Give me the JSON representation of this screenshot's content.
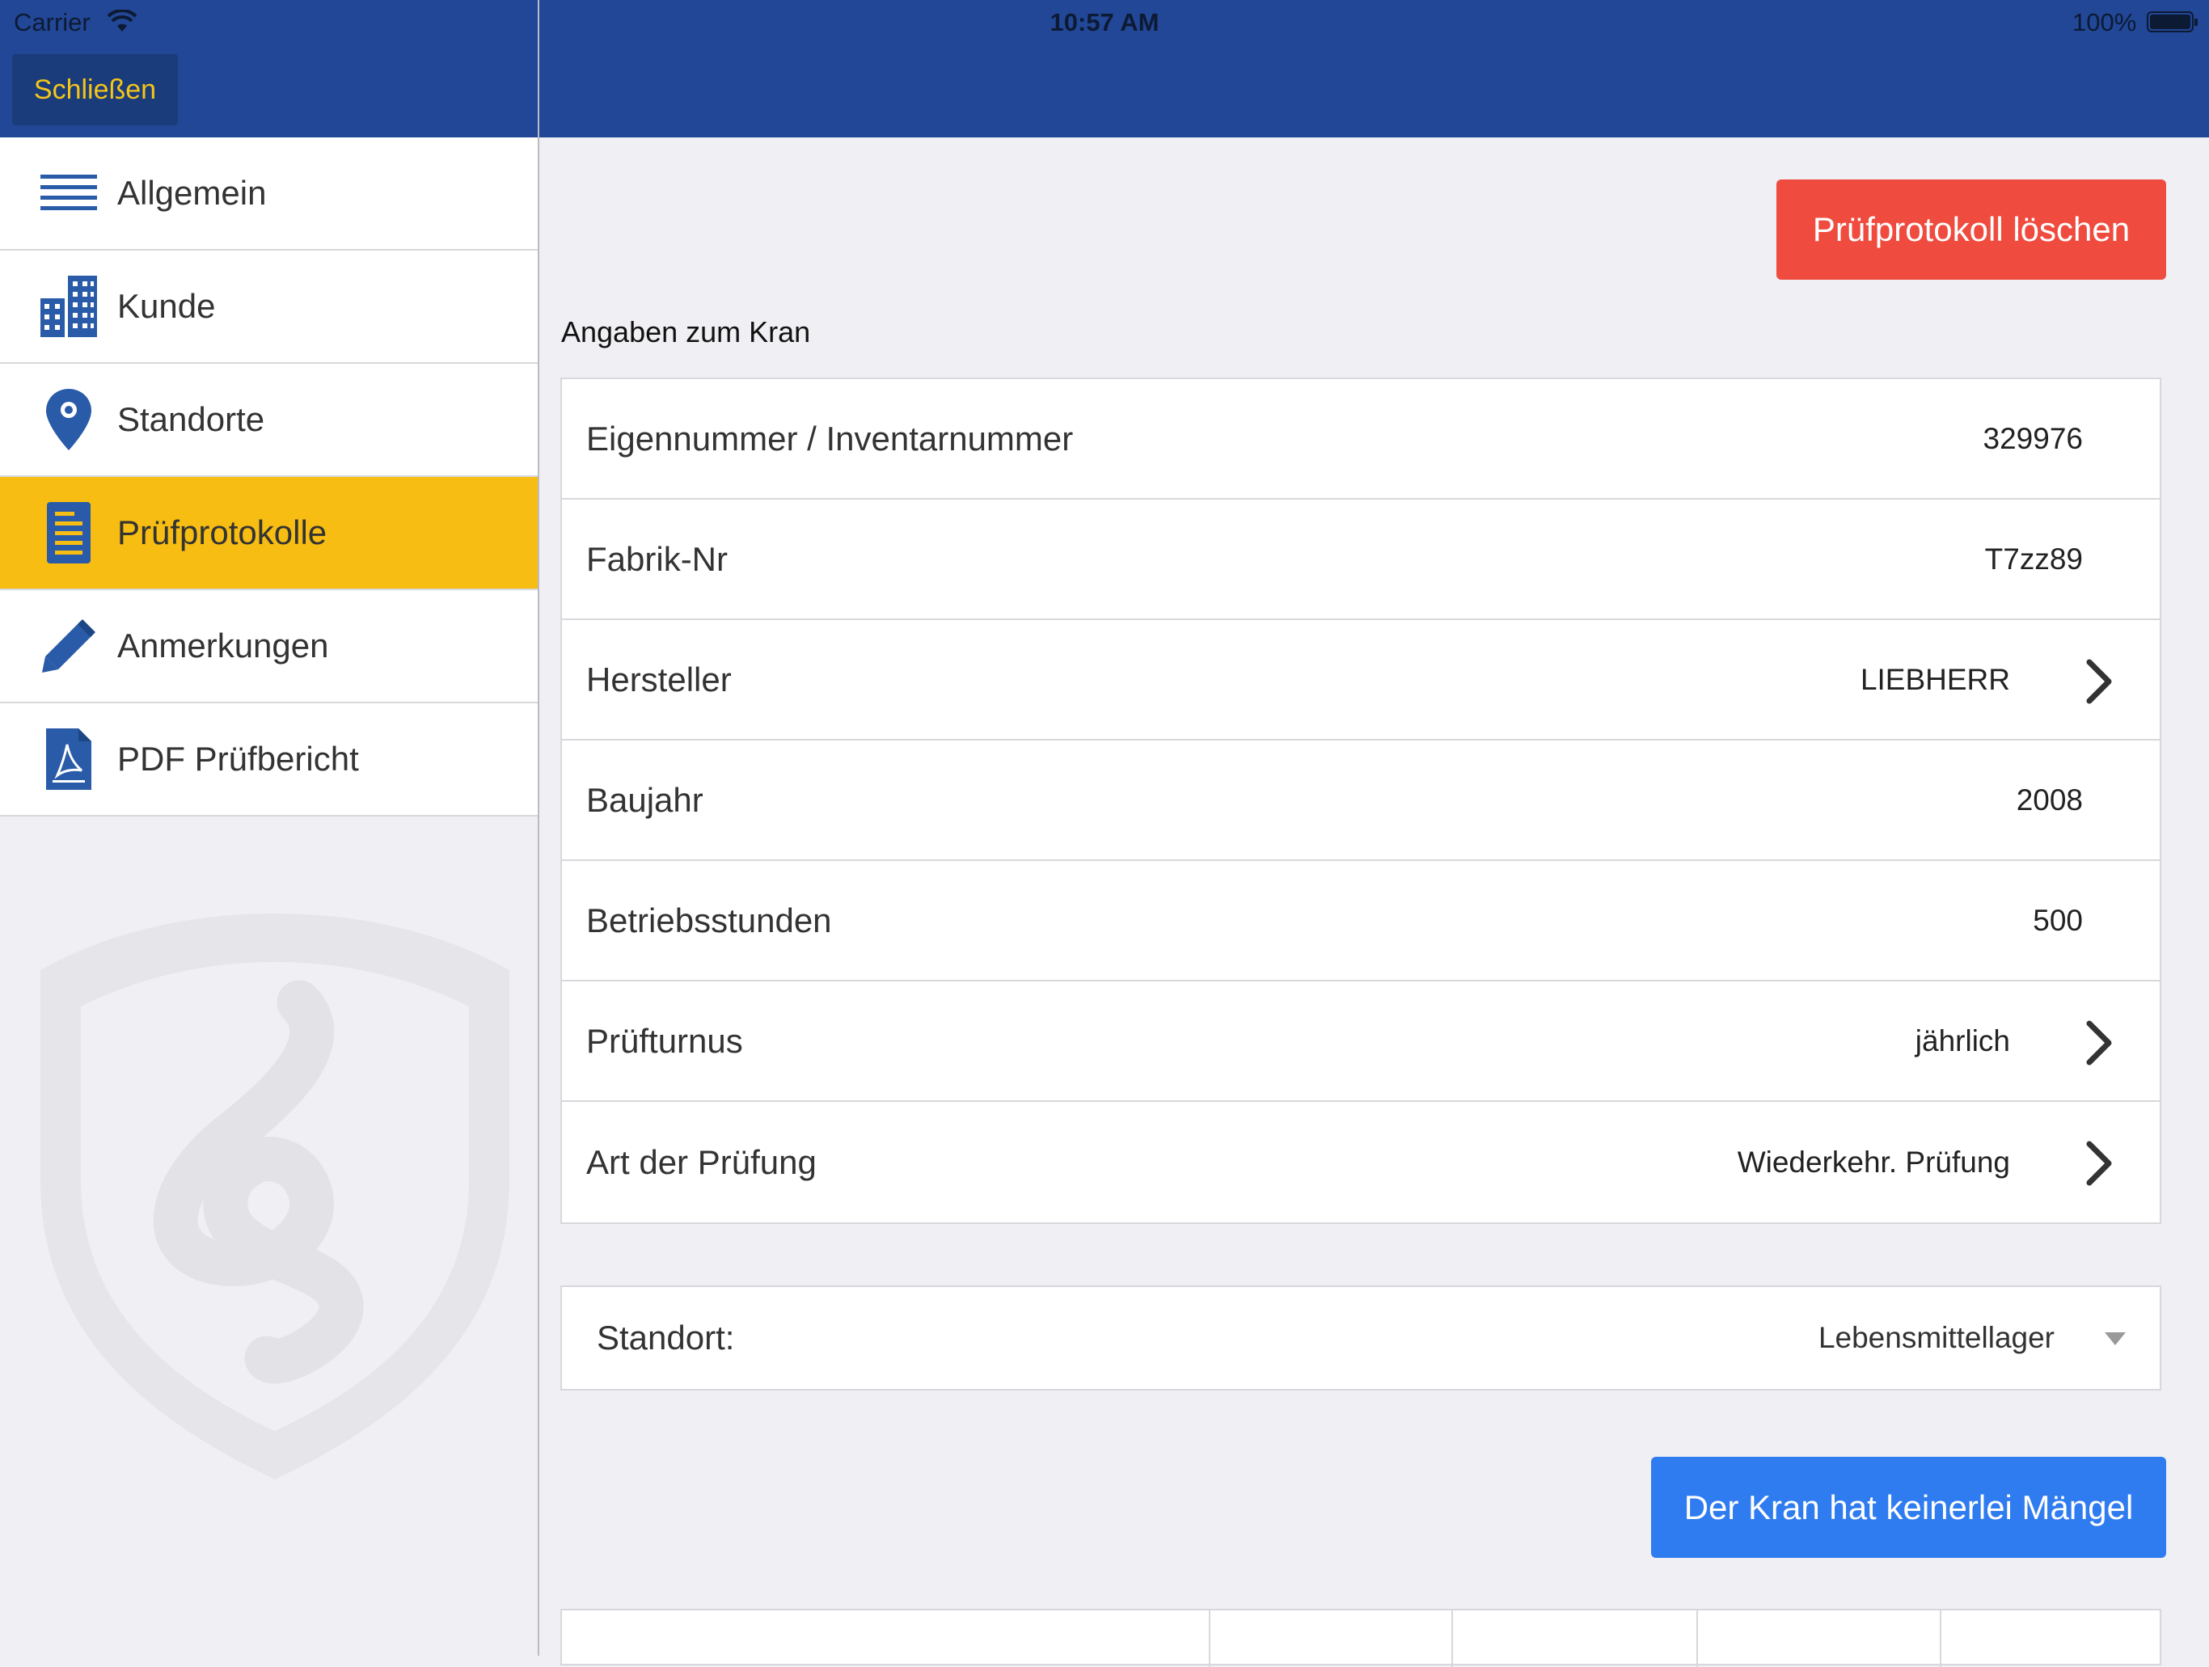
{
  "status_bar": {
    "carrier": "Carrier",
    "time": "10:57 AM",
    "battery": "100%"
  },
  "header": {
    "close_label": "Schließen"
  },
  "sidebar": {
    "items": [
      {
        "label": "Allgemein",
        "icon": "list-icon",
        "active": false
      },
      {
        "label": "Kunde",
        "icon": "building-icon",
        "active": false
      },
      {
        "label": "Standorte",
        "icon": "location-pin-icon",
        "active": false
      },
      {
        "label": "Prüfprotokolle",
        "icon": "document-icon",
        "active": true
      },
      {
        "label": "Anmerkungen",
        "icon": "pencil-icon",
        "active": false
      },
      {
        "label": "PDF Prüfbericht",
        "icon": "pdf-icon",
        "active": false
      }
    ],
    "active_color": "#f7bd12"
  },
  "main": {
    "delete_label": "Prüfprotokoll löschen",
    "section_title": "Angaben zum Kran",
    "fields": [
      {
        "label": "Eigennummer / Inventarnummer",
        "value": "329976",
        "has_chevron": false
      },
      {
        "label": "Fabrik-Nr",
        "value": "T7zz89",
        "has_chevron": false
      },
      {
        "label": "Hersteller",
        "value": "LIEBHERR",
        "has_chevron": true
      },
      {
        "label": "Baujahr",
        "value": "2008",
        "has_chevron": false
      },
      {
        "label": "Betriebsstunden",
        "value": "500",
        "has_chevron": false
      },
      {
        "label": "Prüfturnus",
        "value": "jährlich",
        "has_chevron": true
      },
      {
        "label": "Art der Prüfung",
        "value": "Wiederkehr. Prüfung",
        "has_chevron": true
      }
    ],
    "standort_label": "Standort:",
    "standort_value": "Lebensmittellager",
    "no_defects_label": "Der Kran hat keinerlei Mängel"
  },
  "colors": {
    "header": "#214796",
    "delete": "#ef4b3f",
    "primary": "#2f7cf0",
    "accent": "#f5c518"
  }
}
